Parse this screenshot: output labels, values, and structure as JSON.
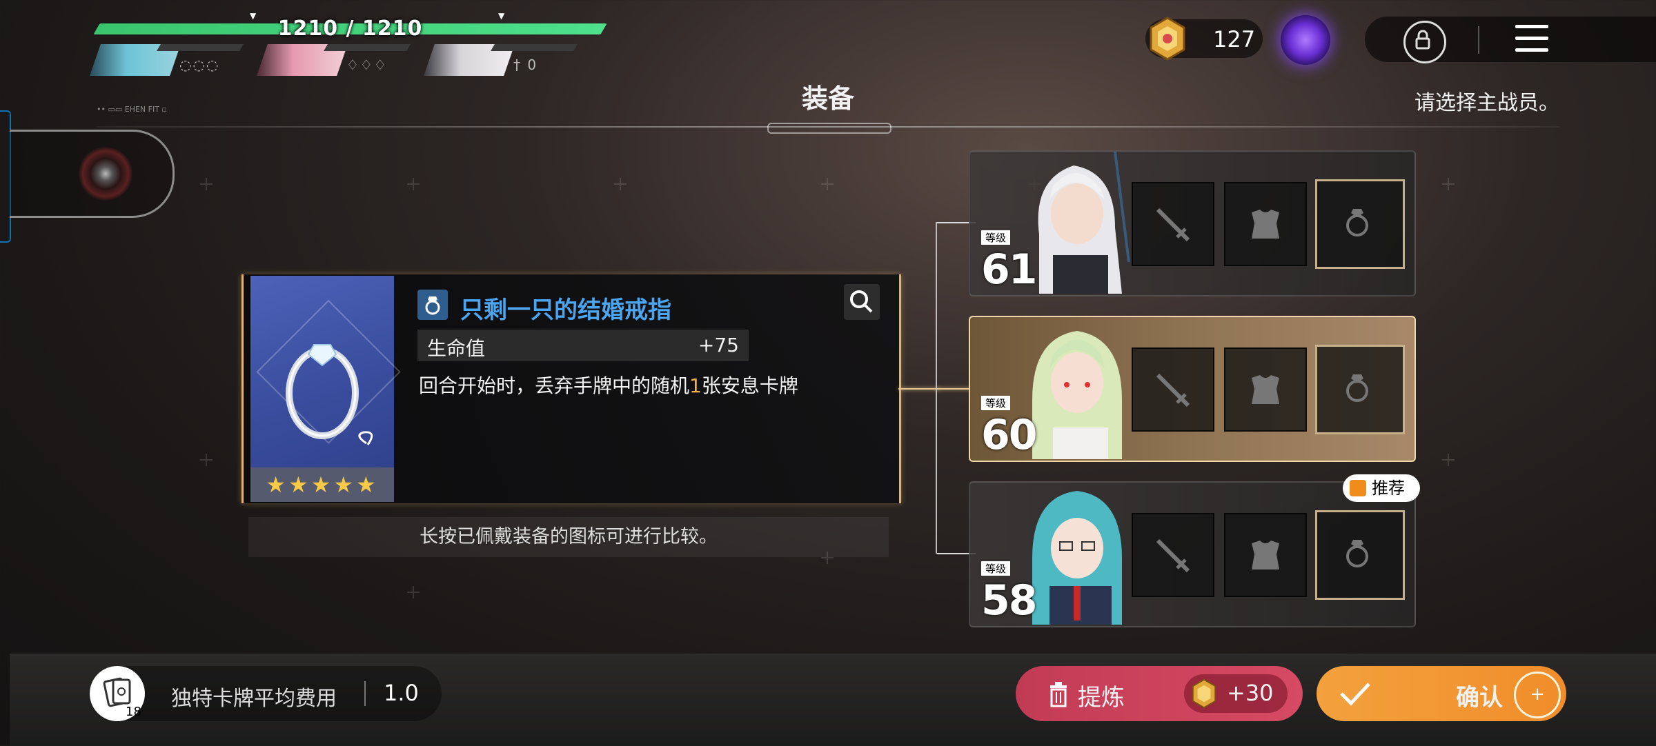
{
  "party": {
    "hp_text": "1210 / 1210",
    "hp_fraction": 1.0,
    "members": [
      {
        "status_icons": "◌◌◌",
        "color": "#6cc3d5"
      },
      {
        "status_icons": "♢♢♢",
        "color": "#e59ab0"
      },
      {
        "status_icons": "† 0",
        "color": "#d7d4d8"
      }
    ]
  },
  "header": {
    "currency_value": "127",
    "title": "装备",
    "hint": "请选择主战员。",
    "tiny_label": "•• ▭▭ EHEN FIT ▫"
  },
  "item": {
    "name": "只剩一只的结婚戒指",
    "stars": "★★★★★",
    "stat_label": "生命值",
    "stat_value": "+75",
    "desc_before": "回合开始时，丢弃手牌中的随机",
    "desc_highlight": "1",
    "desc_after": "张安息卡牌",
    "icon": "ring-icon"
  },
  "tip": "长按已佩戴装备的图标可进行比较。",
  "characters": [
    {
      "level_label": "等级",
      "level": "61",
      "selected": false,
      "recommended": false
    },
    {
      "level_label": "等级",
      "level": "60",
      "selected": true,
      "recommended": false
    },
    {
      "level_label": "等级",
      "level": "58",
      "selected": false,
      "recommended": true
    }
  ],
  "recommend_label": "推荐",
  "bottom": {
    "deck_count": "18",
    "cost_label": "独特卡牌平均费用",
    "cost_value": "1.0",
    "refine_label": "提炼",
    "refine_gain": "+30",
    "confirm_label": "确认",
    "confirm_plus": "+"
  },
  "colors": {
    "accent_gold": "#e2b36a",
    "hp_green": "#4ee08b",
    "item_name_blue": "#4ba5f0",
    "refine_red": "#d64a63",
    "confirm_orange": "#f3a13d"
  }
}
